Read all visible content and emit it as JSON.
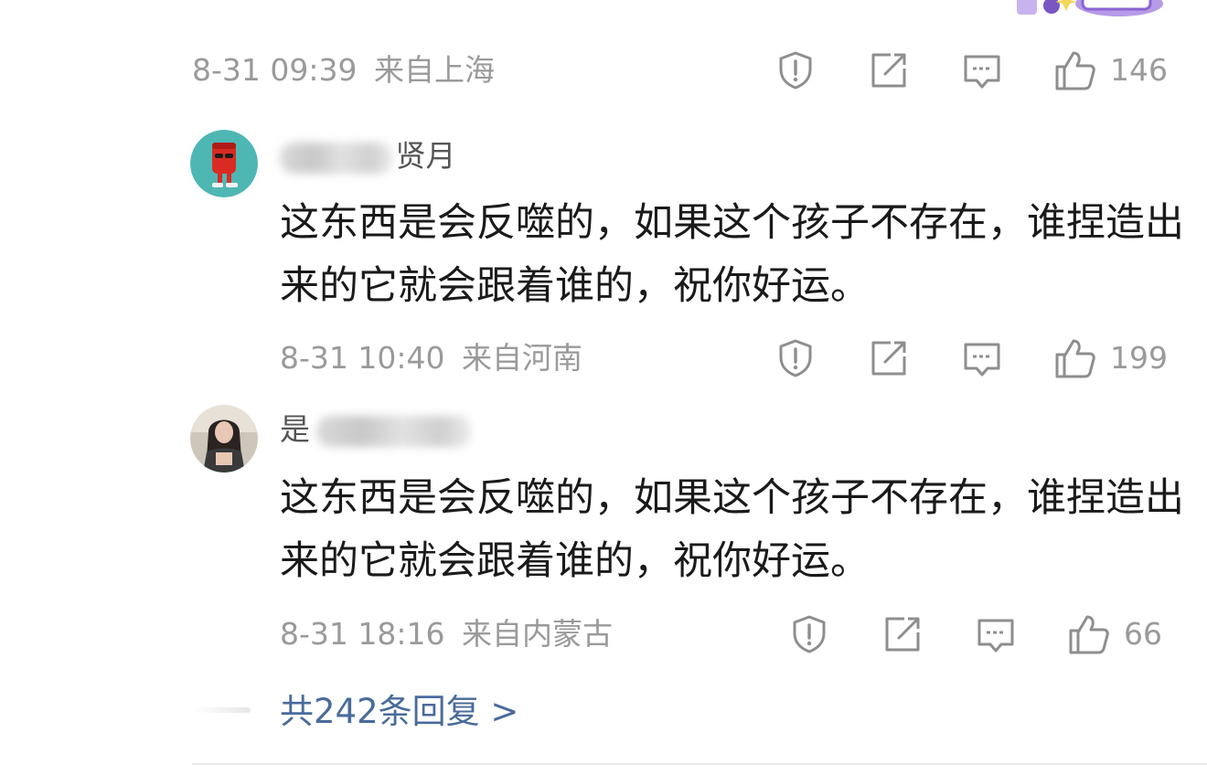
{
  "comments": [
    {
      "time": "8-31 09:39",
      "location": "来自上海",
      "likes": "146"
    },
    {
      "username_visible": "贤月",
      "text": "这东西是会反噬的，如果这个孩子不存在，谁捏造出来的它就会跟着谁的，祝你好运。",
      "time": "8-31 10:40",
      "location": "来自河南",
      "likes": "199"
    },
    {
      "username_visible": "是",
      "text": "这东西是会反噬的，如果这个孩子不存在，谁捏造出来的它就会跟着谁的，祝你好运。",
      "time": "8-31 18:16",
      "location": "来自内蒙古",
      "likes": "66"
    }
  ],
  "replies": {
    "label": "共242条回复 >"
  },
  "icons": {
    "report": "report-icon",
    "share": "share-icon",
    "comment": "comment-icon",
    "like": "thumbs-up-icon",
    "sticker": "sticker-decoration"
  },
  "colors": {
    "meta_gray": "#9a9a9a",
    "icon_gray": "#8e8e8e",
    "reply_link": "#4a6b9c",
    "text": "#1a1a1a"
  }
}
